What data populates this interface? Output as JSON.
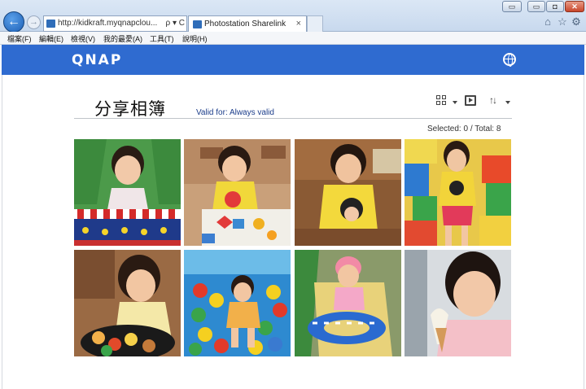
{
  "browser": {
    "address_url": "http://kidkraft.myqnapclou...",
    "address_controls": "ρ ▾ C",
    "tab_title": "Photostation Sharelink",
    "tab_close": "×",
    "window_buttons": {
      "restore_small": "▭",
      "minimize": "▭",
      "maximize": "◘",
      "close": "✕"
    },
    "icons": [
      "back-arrow-icon",
      "forward-arrow-icon",
      "home-icon",
      "star-icon",
      "gear-icon"
    ]
  },
  "menu": [
    "檔案(F)",
    "編輯(E)",
    "檢視(V)",
    "我的最愛(A)",
    "工具(T)",
    "說明(H)"
  ],
  "header": {
    "logo_text": "QNAP",
    "language_icon": "globe-icon",
    "bar_color": "#2f6bd0"
  },
  "album": {
    "title": "分享相簿",
    "valid_for": "Valid for: Always valid",
    "selection_status": "Selected: 0 / Total: 8",
    "toolbar_icons": [
      "grid-view-icon",
      "slideshow-icon",
      "sort-icon"
    ]
  },
  "photos": [
    {
      "name": "photo-1",
      "description": "girl behind green curtain"
    },
    {
      "name": "photo-2",
      "description": "girl playing with shape blocks"
    },
    {
      "name": "photo-3",
      "description": "girl in yellow shirt smiling"
    },
    {
      "name": "photo-4",
      "description": "girl standing by colorful blocks"
    },
    {
      "name": "photo-5",
      "description": "girl with toy food plate"
    },
    {
      "name": "photo-6",
      "description": "girl in ball pit"
    },
    {
      "name": "photo-7",
      "description": "girl in swim ring on slide"
    },
    {
      "name": "photo-8",
      "description": "girl with ice cream"
    }
  ]
}
